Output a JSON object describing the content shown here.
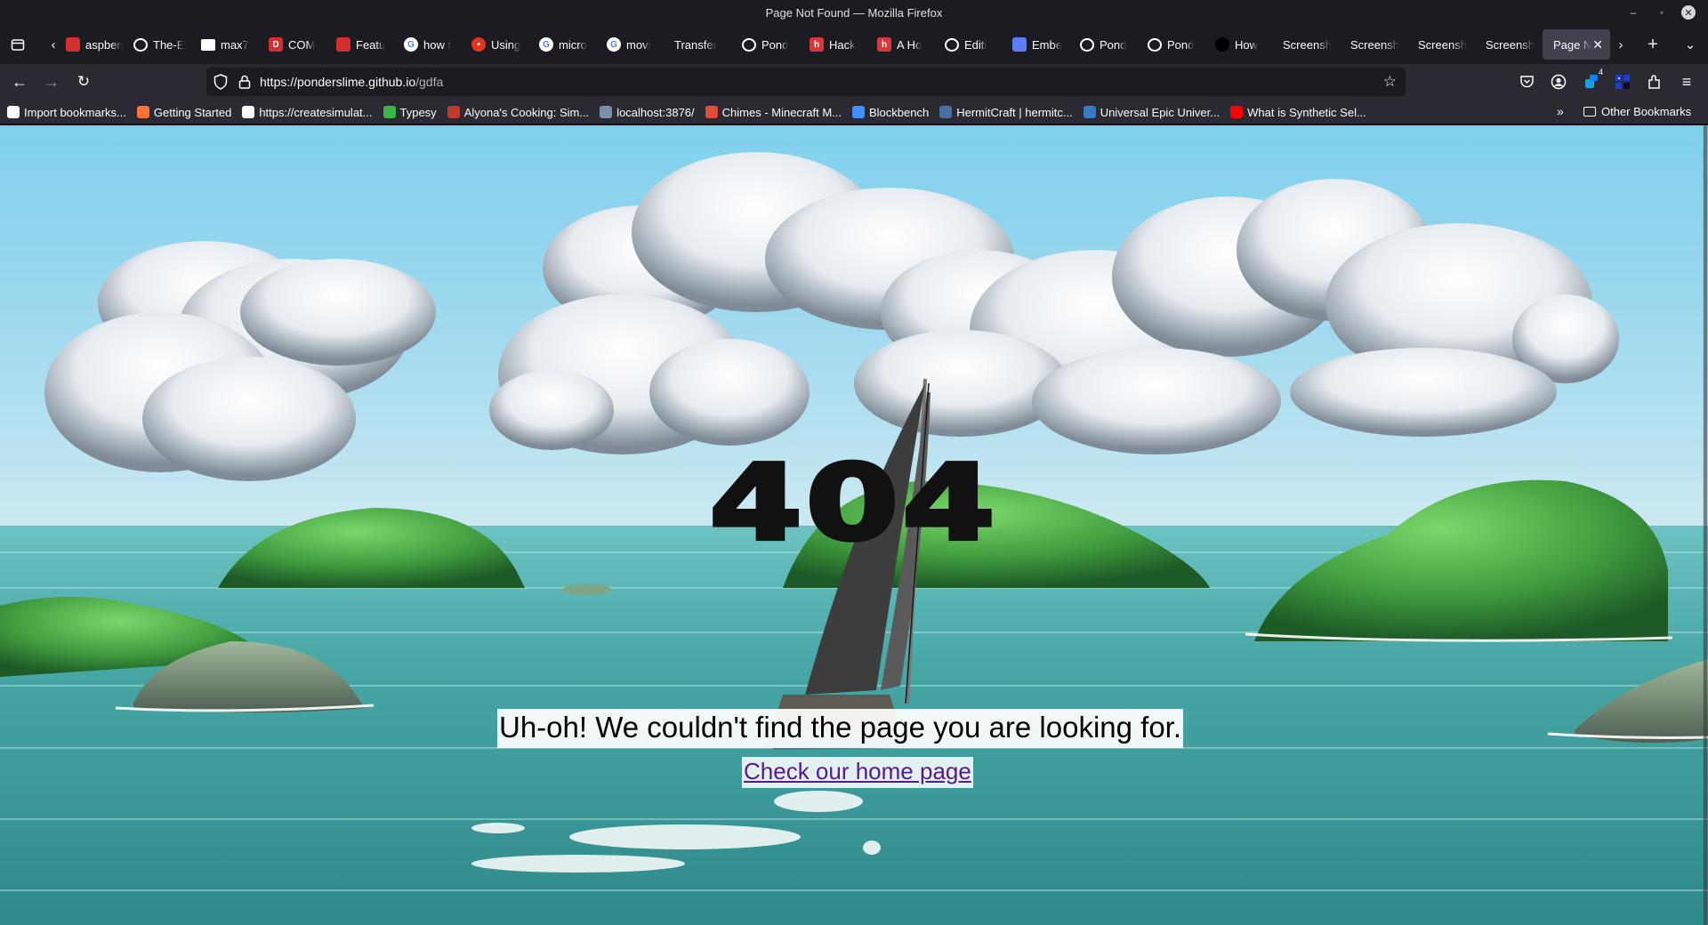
{
  "window": {
    "title": "Page Not Found — Mozilla Firefox",
    "controls": [
      "minimize-icon",
      "maximize-icon",
      "close-icon"
    ]
  },
  "tabs": [
    {
      "label": "aspberr",
      "icon": "raspberry-icon"
    },
    {
      "label": "The-E",
      "icon": "github-icon"
    },
    {
      "label": "max7",
      "icon": "cube-icon"
    },
    {
      "label": "COM",
      "icon": "doc-icon"
    },
    {
      "label": "Featu",
      "icon": "flag-icon"
    },
    {
      "label": "how t",
      "icon": "google-icon"
    },
    {
      "label": "Using",
      "icon": "reddit-icon"
    },
    {
      "label": "micro",
      "icon": "google-icon"
    },
    {
      "label": "movi",
      "icon": "google-icon"
    },
    {
      "label": "Transfer",
      "icon": ""
    },
    {
      "label": "Pond",
      "icon": "github-icon"
    },
    {
      "label": "Hack",
      "icon": "hackaday-icon"
    },
    {
      "label": "A Ho",
      "icon": "hackaday-icon"
    },
    {
      "label": "Editi",
      "icon": "github-icon"
    },
    {
      "label": "Embe",
      "icon": "embed-icon"
    },
    {
      "label": "Pond",
      "icon": "github-icon"
    },
    {
      "label": "Pond",
      "icon": "github-icon"
    },
    {
      "label": "How",
      "icon": "dark-icon"
    },
    {
      "label": "Screensh",
      "icon": ""
    },
    {
      "label": "Screensh",
      "icon": ""
    },
    {
      "label": "Screensh",
      "icon": ""
    },
    {
      "label": "Screensh",
      "icon": ""
    },
    {
      "label": "Page N",
      "icon": "",
      "active": true
    }
  ],
  "navbar": {
    "url_host": "https://ponderslime.github.io",
    "url_path": "/gdfa",
    "extension_badge": "4"
  },
  "bookmarks": [
    {
      "label": "Import bookmarks...",
      "icon": "import-icon",
      "color": "#fbfbfe"
    },
    {
      "label": "Getting Started",
      "icon": "firefox-icon",
      "color": "#ff7139"
    },
    {
      "label": "https://createsimulat...",
      "icon": "globe-icon",
      "color": "#fbfbfe"
    },
    {
      "label": "Typesy",
      "icon": "typesy-icon",
      "color": "#3bb54a"
    },
    {
      "label": "Alyona's Cooking: Sim...",
      "icon": "knife-icon",
      "color": "#c0392b"
    },
    {
      "label": "localhost:3876/",
      "icon": "localhost-icon",
      "color": "#7d8fa8"
    },
    {
      "label": "Chimes - Minecraft M...",
      "icon": "curseforge-icon",
      "color": "#e04e39"
    },
    {
      "label": "Blockbench",
      "icon": "blockbench-icon",
      "color": "#3e90ff"
    },
    {
      "label": "HermitCraft | hermitc...",
      "icon": "hermit-icon",
      "color": "#4a6fa5"
    },
    {
      "label": "Universal Epic Univer...",
      "icon": "universe-icon",
      "color": "#3a78c8"
    },
    {
      "label": "What is Synthetic Sel...",
      "icon": "youtube-icon",
      "color": "#ff0000"
    }
  ],
  "bookmarks_other": "Other Bookmarks",
  "page": {
    "heading": "404",
    "message": "Uh-oh! We couldn't find the page you are looking for.",
    "home_link": "Check our home page"
  },
  "colors": {
    "sky_top": "#8fd3ef",
    "sea": "#3a9c95",
    "island": "#3f9a3f",
    "link": "#551a8b"
  }
}
